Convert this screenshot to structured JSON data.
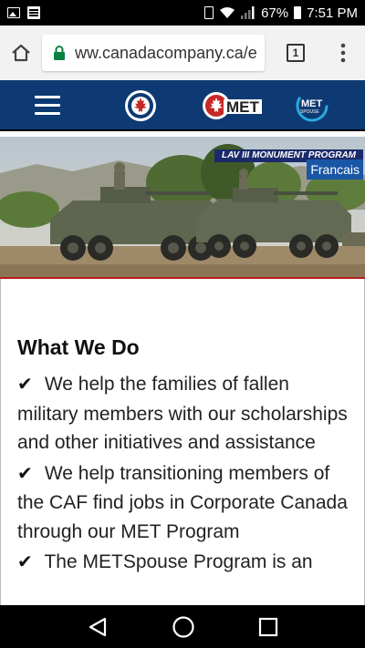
{
  "status_bar": {
    "battery": "67%",
    "time": "7:51 PM",
    "icons": [
      "image-icon",
      "document-icon",
      "vibrate-icon",
      "wifi-icon",
      "signal-icon",
      "battery-icon"
    ]
  },
  "browser": {
    "url": "ww.canadacompany.ca/e",
    "tab_count": "1"
  },
  "site_nav": {
    "logo_met": "MET",
    "logo_metspouse_top": "MET",
    "logo_metspouse_bottom": "SPOUSE",
    "colors": {
      "nav_bg": "#0d3a72",
      "accent_red": "#c62828"
    }
  },
  "hero": {
    "caption": "LAV III MONUMENT PROGRAM",
    "language_button": "Francais"
  },
  "content": {
    "heading": "What We Do",
    "bullets": [
      "We help the families of fallen military members with our scholarships and other initiatives and assistance",
      "We help transitioning members of the CAF find jobs in Corporate Canada through our MET Program",
      "The METSpouse Program is an"
    ]
  }
}
